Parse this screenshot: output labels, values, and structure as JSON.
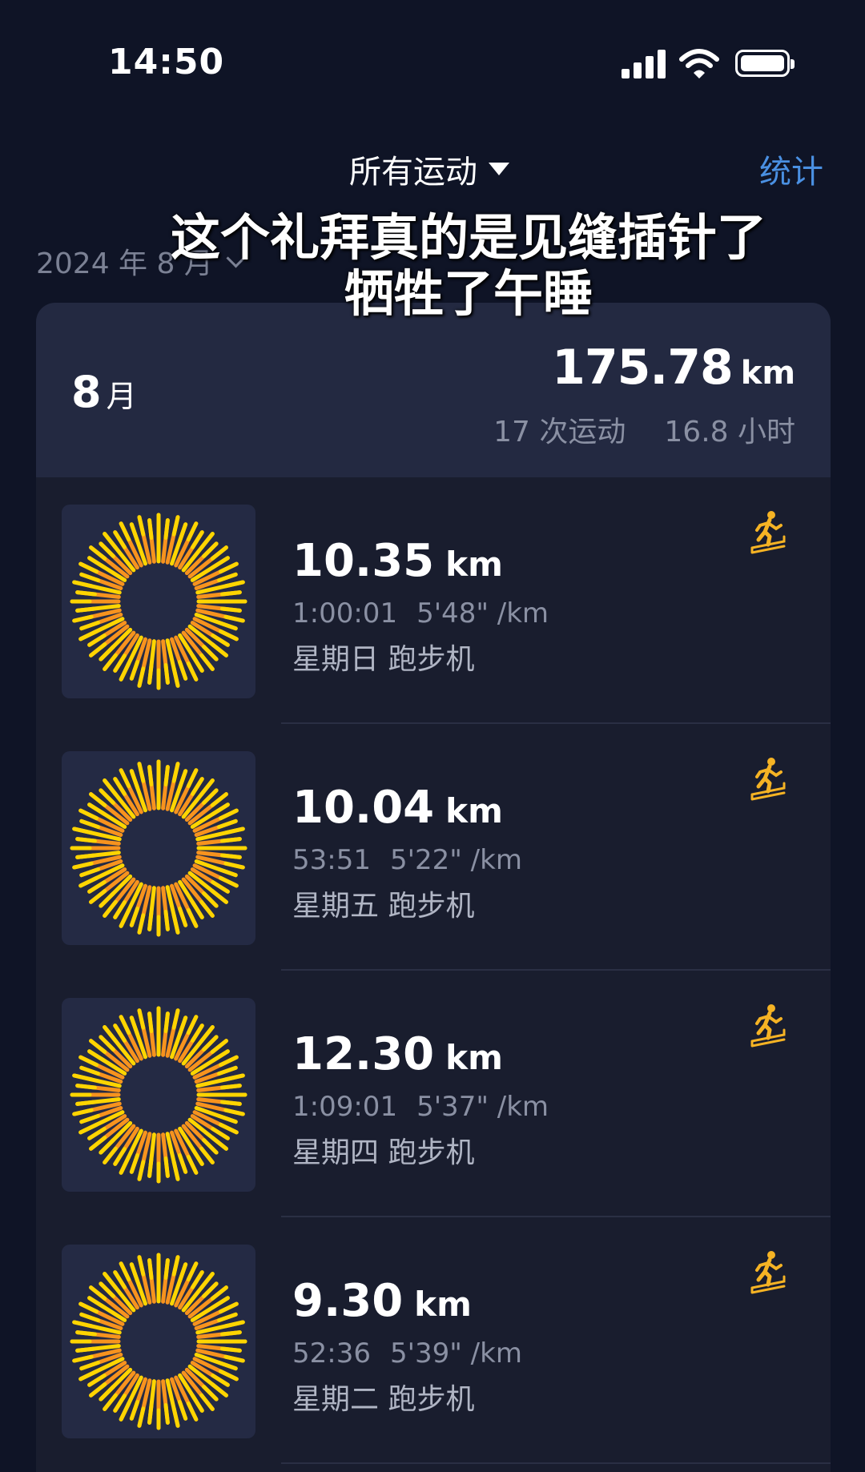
{
  "status_bar": {
    "time": "14:50"
  },
  "header": {
    "filter_label": "所有运动",
    "stats_link": "统计"
  },
  "month_selector": {
    "label": "2024 年 8 月"
  },
  "overlay": {
    "line1": "这个礼拜真的是见缝插针了",
    "line2": "牺牲了午睡"
  },
  "summary": {
    "month_number": "8",
    "month_unit": "月",
    "distance": "175.78",
    "distance_unit": "km",
    "workouts": "17 次运动",
    "hours": "16.8 小时"
  },
  "workouts": [
    {
      "distance": "10.35",
      "unit": "km",
      "duration": "1:00:01",
      "pace": "5'48\" /km",
      "day": "星期日 跑步机",
      "icon": "treadmill-icon"
    },
    {
      "distance": "10.04",
      "unit": "km",
      "duration": "53:51",
      "pace": "5'22\" /km",
      "day": "星期五 跑步机",
      "icon": "treadmill-icon"
    },
    {
      "distance": "12.30",
      "unit": "km",
      "duration": "1:09:01",
      "pace": "5'37\" /km",
      "day": "星期四 跑步机",
      "icon": "treadmill-icon"
    },
    {
      "distance": "9.30",
      "unit": "km",
      "duration": "52:36",
      "pace": "5'39\" /km",
      "day": "星期二 跑步机",
      "icon": "treadmill-icon"
    }
  ],
  "colors": {
    "background": "#0f1426",
    "card": "#191d2e",
    "summary": "#232941",
    "accent_blue": "#4a90e2",
    "sun_orange": "#f7931e",
    "sun_yellow": "#ffd500"
  }
}
